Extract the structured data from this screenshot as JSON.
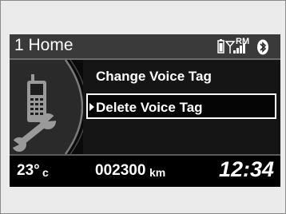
{
  "header": {
    "title": "1 Home",
    "roaming_badge": "RM"
  },
  "icons": {
    "battery": "battery-icon",
    "signal": "signal-strength-icon",
    "bluetooth": "bluetooth-icon",
    "phone": "mobile-phone-icon",
    "settings": "wrench-icon"
  },
  "menu": {
    "items": [
      {
        "label": "Change Voice Tag",
        "selected": false
      },
      {
        "label": "Delete Voice Tag",
        "selected": true
      }
    ]
  },
  "status": {
    "temperature": "23°",
    "temperature_unit": "c",
    "odometer": "002300",
    "odometer_unit": "km",
    "clock": "12:34"
  }
}
